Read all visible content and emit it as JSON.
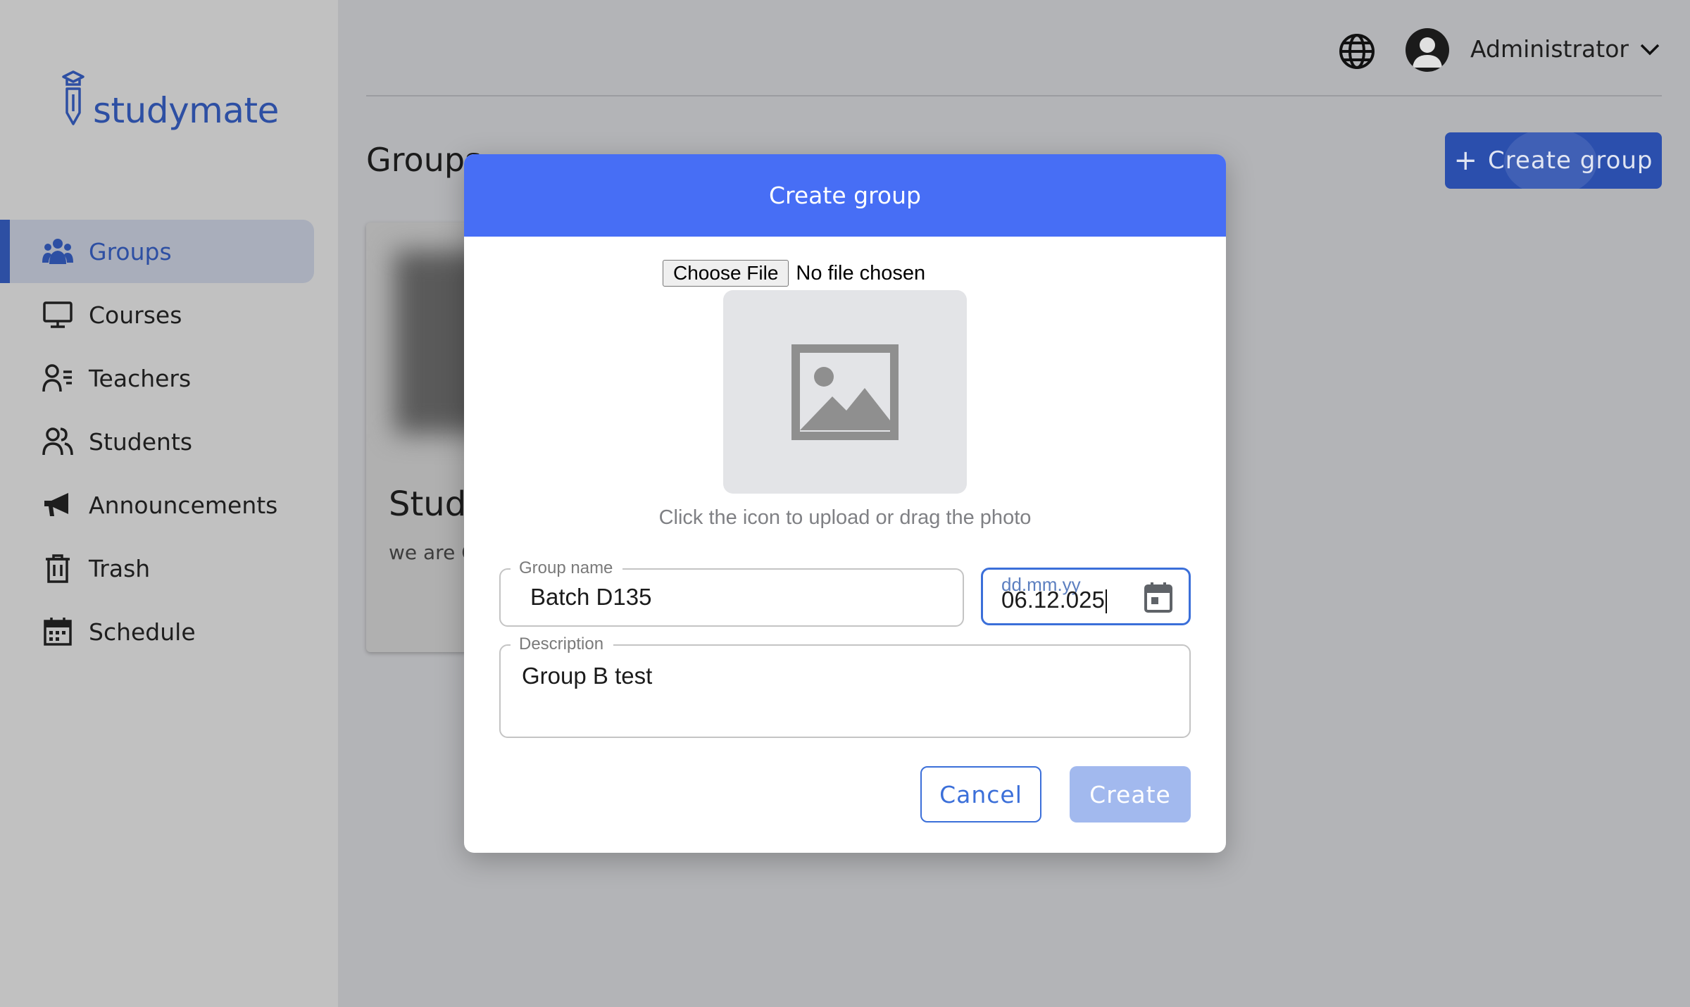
{
  "app": {
    "logo_text": "studymate"
  },
  "colors": {
    "brand": "#2d4fa3",
    "modal_header": "#476ef5",
    "primary": "#3b6fd9",
    "create_disabled": "#a2b9ee"
  },
  "sidebar": {
    "items": [
      {
        "label": "Groups",
        "icon": "groups-icon",
        "active": true
      },
      {
        "label": "Courses",
        "icon": "monitor-icon",
        "active": false
      },
      {
        "label": "Teachers",
        "icon": "teacher-icon",
        "active": false
      },
      {
        "label": "Students",
        "icon": "students-icon",
        "active": false
      },
      {
        "label": "Announcements",
        "icon": "megaphone-icon",
        "active": false
      },
      {
        "label": "Trash",
        "icon": "trash-icon",
        "active": false
      },
      {
        "label": "Schedule",
        "icon": "calendar-icon",
        "active": false
      }
    ]
  },
  "header": {
    "user_name": "Administrator",
    "language_icon": "globe-icon",
    "avatar_icon": "user-avatar-icon"
  },
  "main": {
    "title": "Groups",
    "create_button_label": "Create group",
    "card": {
      "title": "Stude",
      "description": "we are C"
    }
  },
  "modal": {
    "title": "Create group",
    "file_button_label": "Choose File",
    "file_status": "No file chosen",
    "upload_hint": "Click the icon to upload or drag the photo",
    "group_name": {
      "label": "Group name",
      "value": "Batch D135"
    },
    "date": {
      "placeholder": "dd.mm.yy",
      "value": "06.12.025"
    },
    "description": {
      "label": "Description",
      "value": "Group B test"
    },
    "cancel_label": "Cancel",
    "create_label": "Create"
  }
}
